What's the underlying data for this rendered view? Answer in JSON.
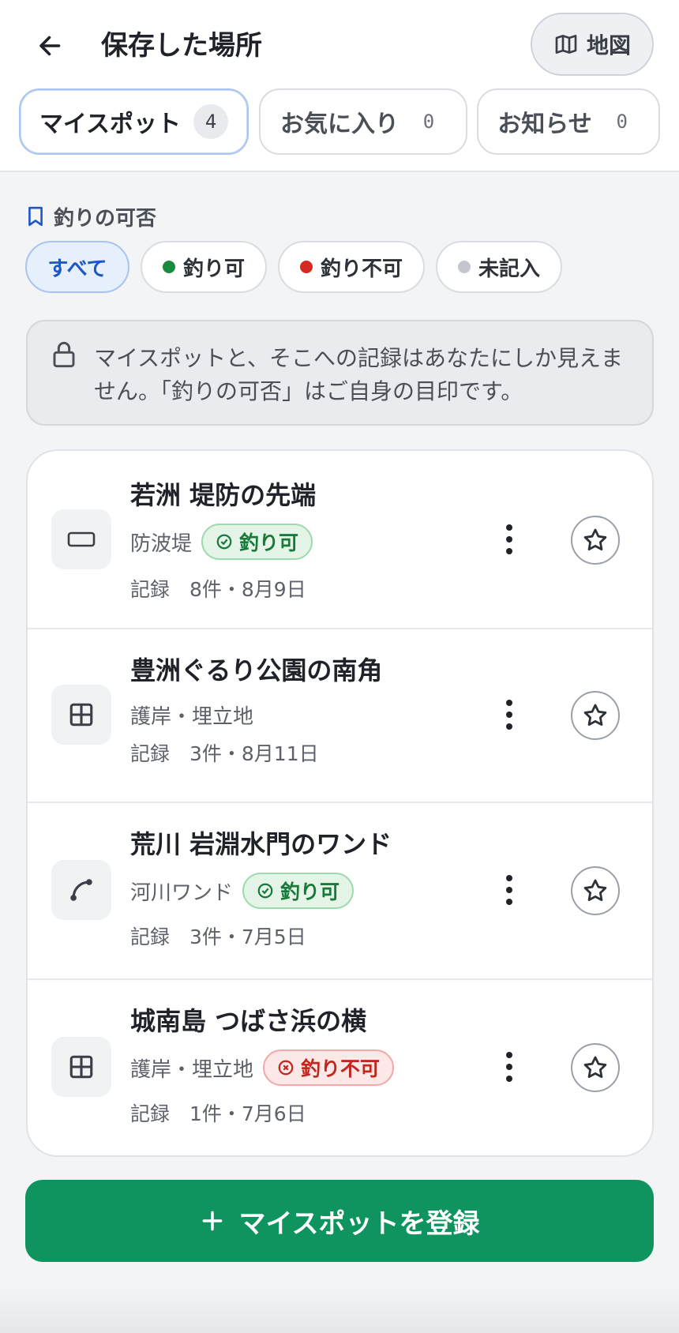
{
  "header": {
    "title": "保存した場所",
    "back_icon": "arrow-left-icon",
    "map_button": {
      "label": "地図",
      "icon": "map-icon"
    }
  },
  "tabs": [
    {
      "label": "マイスポット",
      "count": "4",
      "active": true
    },
    {
      "label": "お気に入り",
      "count": "0",
      "active": false
    },
    {
      "label": "お知らせ",
      "count": "0",
      "active": false
    }
  ],
  "filter": {
    "label": "釣りの可否",
    "icon": "bookmark-icon",
    "chips": [
      {
        "label": "すべて",
        "active": true
      },
      {
        "label": "釣り可",
        "dot_color": "#1a8a3e"
      },
      {
        "label": "釣り不可",
        "dot_color": "#d42a22"
      },
      {
        "label": "未記入",
        "dot_color": "#c3c7cd"
      }
    ]
  },
  "notice": {
    "icon": "lock-icon",
    "text": "マイスポットと、そこへの記録はあなたにしか見えません。「釣りの可否」はご自身の目印です。"
  },
  "spots": [
    {
      "name": "若洲 堤防の先端",
      "type": "防波堤",
      "type_icon": "breakwater-icon",
      "status": "釣り可",
      "status_kind": "ok",
      "record": "記録　8件・8月9日"
    },
    {
      "name": "豊洲ぐるり公園の南角",
      "type": "護岸・埋立地",
      "type_icon": "grid-icon",
      "status": "",
      "status_kind": "none",
      "record": "記録　3件・8月11日"
    },
    {
      "name": "荒川 岩淵水門のワンド",
      "type": "河川ワンド",
      "type_icon": "river-curve-icon",
      "status": "釣り可",
      "status_kind": "ok",
      "record": "記録　3件・7月5日"
    },
    {
      "name": "城南島 つばさ浜の横",
      "type": "護岸・埋立地",
      "type_icon": "grid-icon",
      "status": "釣り不可",
      "status_kind": "ng",
      "record": "記録　1件・7月6日"
    }
  ],
  "register_button": {
    "label": "マイスポットを登録",
    "icon": "plus-icon"
  },
  "colors": {
    "primary_green": "#0f9460",
    "active_blue": "#1e56c7",
    "ok_green": "#177a3a",
    "ng_red": "#c0271f"
  }
}
